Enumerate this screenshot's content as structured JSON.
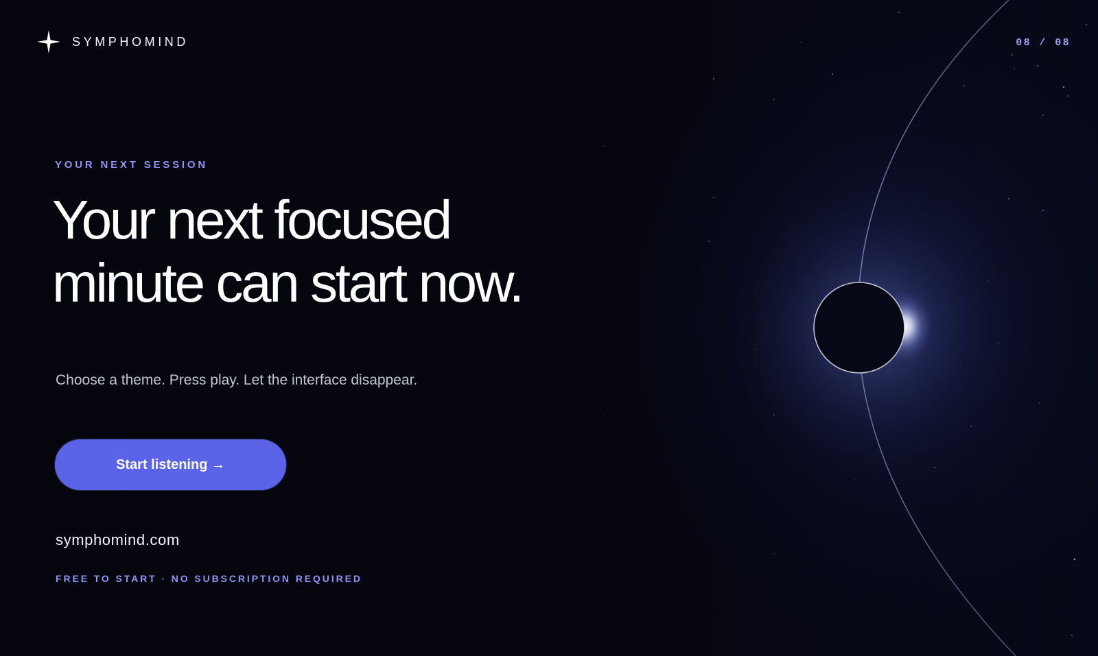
{
  "header": {
    "brand_name": "SYMPHOMIND",
    "brand_icon": "four-point-star-icon",
    "slide_counter": "08 / 08"
  },
  "hero": {
    "eyebrow": "YOUR NEXT SESSION",
    "headline_line1": "Your next focused",
    "headline_line2": "minute can start now.",
    "subtext": "Choose a theme. Press play. Let the interface disappear.",
    "cta_label": "Start listening →"
  },
  "footer": {
    "website": "symphomind.com",
    "fineprint": "FREE TO START · NO SUBSCRIPTION REQUIRED"
  },
  "colors": {
    "background": "#05060d",
    "accent": "#5b63e8",
    "accent_text": "#8f95f4",
    "headline": "#ffffff",
    "body_text": "#c4c6d2"
  }
}
